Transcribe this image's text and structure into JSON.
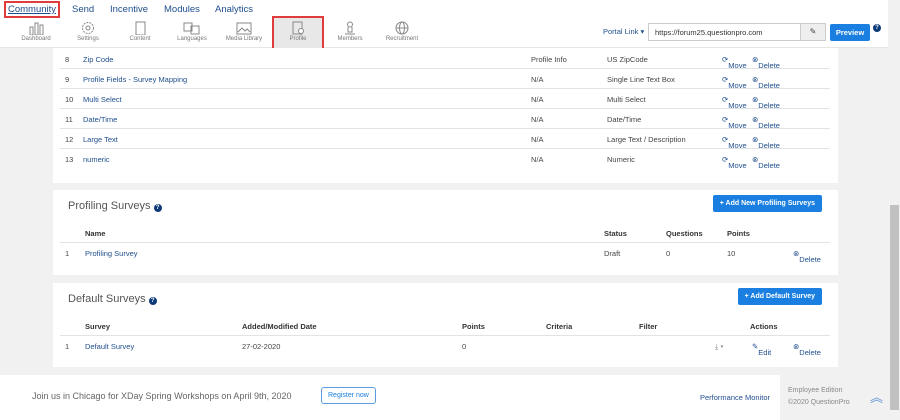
{
  "nav": {
    "items": [
      "Community",
      "Send",
      "Incentive",
      "Modules",
      "Analytics"
    ]
  },
  "toolbar": {
    "items": [
      "Dashboard",
      "Settings",
      "Content",
      "Languages",
      "Media Library",
      "Profile",
      "Members",
      "Recruitment"
    ],
    "active": "Profile"
  },
  "portal": {
    "label": "Portal Link",
    "url": "https://forum25.questionpro.com",
    "preview": "Preview",
    "help": "?"
  },
  "fields": {
    "rows": [
      {
        "num": "8",
        "name": "Zip Code",
        "category": "Profile Info",
        "type": "US ZipCode"
      },
      {
        "num": "9",
        "name": "Profile Fields - Survey Mapping",
        "category": "N/A",
        "type": "Single Line Text Box"
      },
      {
        "num": "10",
        "name": "Multi Select",
        "category": "N/A",
        "type": "Multi Select"
      },
      {
        "num": "11",
        "name": "Date/Time",
        "category": "N/A",
        "type": "Date/Time"
      },
      {
        "num": "12",
        "name": "Large Text",
        "category": "N/A",
        "type": "Large Text / Description"
      },
      {
        "num": "13",
        "name": "numeric",
        "category": "N/A",
        "type": "Numeric"
      }
    ],
    "move": "Move",
    "delete": "Delete"
  },
  "profiling": {
    "title": "Profiling Surveys",
    "add": "+ Add New Profiling Surveys",
    "headers": [
      "Name",
      "Status",
      "Questions",
      "Points"
    ],
    "rows": [
      {
        "num": "1",
        "name": "Profiling Survey",
        "status": "Draft",
        "questions": "0",
        "points": "10",
        "delete": "Delete"
      }
    ]
  },
  "defaults": {
    "title": "Default Surveys",
    "add": "+ Add Default Survey",
    "headers": [
      "Survey",
      "Added/Modified Date",
      "Points",
      "Criteria",
      "Filter",
      "Actions"
    ],
    "rows": [
      {
        "num": "1",
        "name": "Default Survey",
        "date": "27-02-2020",
        "points": "0",
        "edit": "Edit",
        "delete": "Delete"
      }
    ]
  },
  "footer": {
    "promo": "Join us in Chicago for XDay Spring Workshops on April 9th, 2020",
    "register": "Register now",
    "perf": "Performance Monitor",
    "edition": "Employee Edition",
    "copyright": "©2020 QuestionPro"
  },
  "colors": {
    "accent": "#1a7fe0",
    "link": "#1f4e8c",
    "highlight": "#e03c3c"
  }
}
